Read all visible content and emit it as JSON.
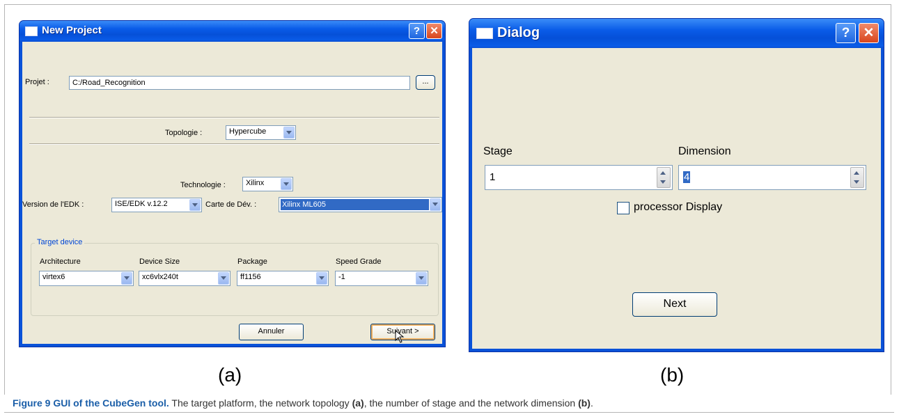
{
  "window_a": {
    "title": "New Project",
    "help_label": "?",
    "close_label": "✕",
    "project_label": "Projet :",
    "project_value": "C:/Road_Recognition",
    "browse_label": "...",
    "topology_label": "Topologie :",
    "topology_value": "Hypercube",
    "technology_label": "Technologie :",
    "technology_value": "Xilinx",
    "edk_version_label": "Version de l'EDK :",
    "edk_version_value": "ISE/EDK v.12.2",
    "board_label": "Carte de Dév. :",
    "board_value": "Xilinx ML605",
    "target_device": {
      "group_title": "Target device",
      "columns": [
        {
          "label": "Architecture",
          "value": "virtex6"
        },
        {
          "label": "Device Size",
          "value": "xc6vlx240t"
        },
        {
          "label": "Package",
          "value": "ff1156"
        },
        {
          "label": "Speed Grade",
          "value": "-1"
        }
      ]
    },
    "cancel_label": "Annuler",
    "next_label": "Suivant >"
  },
  "window_b": {
    "title": "Dialog",
    "help_label": "?",
    "close_label": "✕",
    "stage_label": "Stage",
    "stage_value": "1",
    "dimension_label": "Dimension",
    "dimension_value": "4",
    "processor_display_label": "processor Display",
    "processor_display_checked": false,
    "next_label": "Next"
  },
  "captions": {
    "a": "(a)",
    "b": "(b)"
  },
  "figure_caption": {
    "lead": "Figure 9 GUI of the CubeGen tool.",
    "text_1": " The target platform, the network topology ",
    "bold_a": "(a)",
    "text_2": ", the number of stage and the network dimension ",
    "bold_b": "(b)",
    "text_3": "."
  },
  "colors": {
    "title_bar": "#0a5ce8",
    "client_bg": "#ece9d8",
    "selection": "#316ac5",
    "caption_lead": "#1a5ea8"
  }
}
